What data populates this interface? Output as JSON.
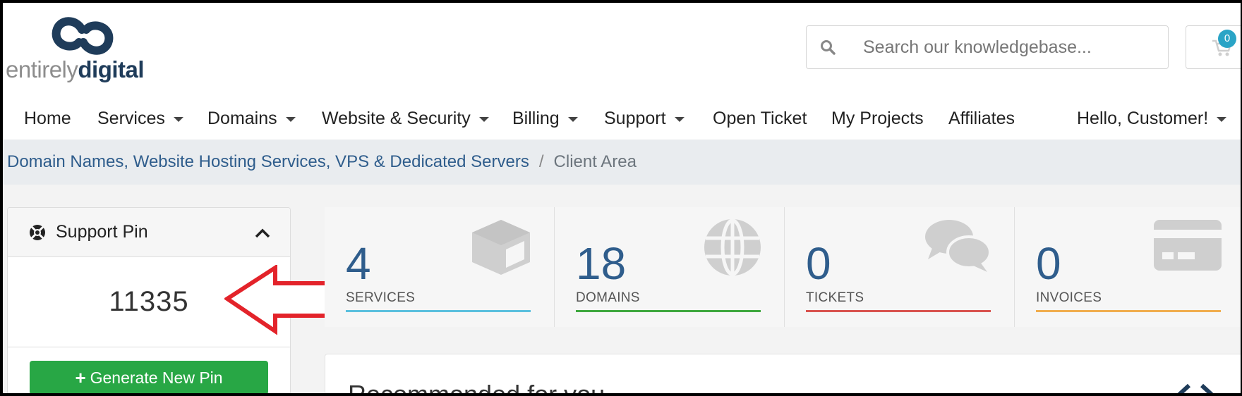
{
  "brand": {
    "name_light": "entirely",
    "name_bold": "digital"
  },
  "search": {
    "placeholder": "Search our knowledgebase..."
  },
  "cart": {
    "count": "0"
  },
  "nav": {
    "items": [
      {
        "label": "Home",
        "dropdown": false
      },
      {
        "label": "Services",
        "dropdown": true
      },
      {
        "label": "Domains",
        "dropdown": true
      },
      {
        "label": "Website & Security",
        "dropdown": true
      },
      {
        "label": "Billing",
        "dropdown": true
      },
      {
        "label": "Support",
        "dropdown": true
      },
      {
        "label": "Open Ticket",
        "dropdown": false
      },
      {
        "label": "My Projects",
        "dropdown": false
      },
      {
        "label": "Affiliates",
        "dropdown": false
      }
    ],
    "account": "Hello, Customer!"
  },
  "breadcrumb": {
    "home": "Domain Names, Website Hosting Services, VPS & Dedicated Servers",
    "separator": "/",
    "current": "Client Area"
  },
  "support_pin": {
    "title": "Support Pin",
    "value": "11335",
    "button": "Generate New Pin"
  },
  "stats": [
    {
      "value": "4",
      "label": "SERVICES",
      "color": "#5bc0de",
      "icon": "cube-icon"
    },
    {
      "value": "18",
      "label": "DOMAINS",
      "color": "#3fa83f",
      "icon": "globe-icon"
    },
    {
      "value": "0",
      "label": "TICKETS",
      "color": "#d9534f",
      "icon": "comments-icon"
    },
    {
      "value": "0",
      "label": "INVOICES",
      "color": "#f0ad4e",
      "icon": "credit-card-icon"
    }
  ],
  "recommended": {
    "title": "Recommended for you"
  },
  "colors": {
    "brand_dark": "#1f3c5a",
    "link": "#2f5d8c",
    "button_green": "#28a745",
    "arrow_red": "#e3232a"
  }
}
